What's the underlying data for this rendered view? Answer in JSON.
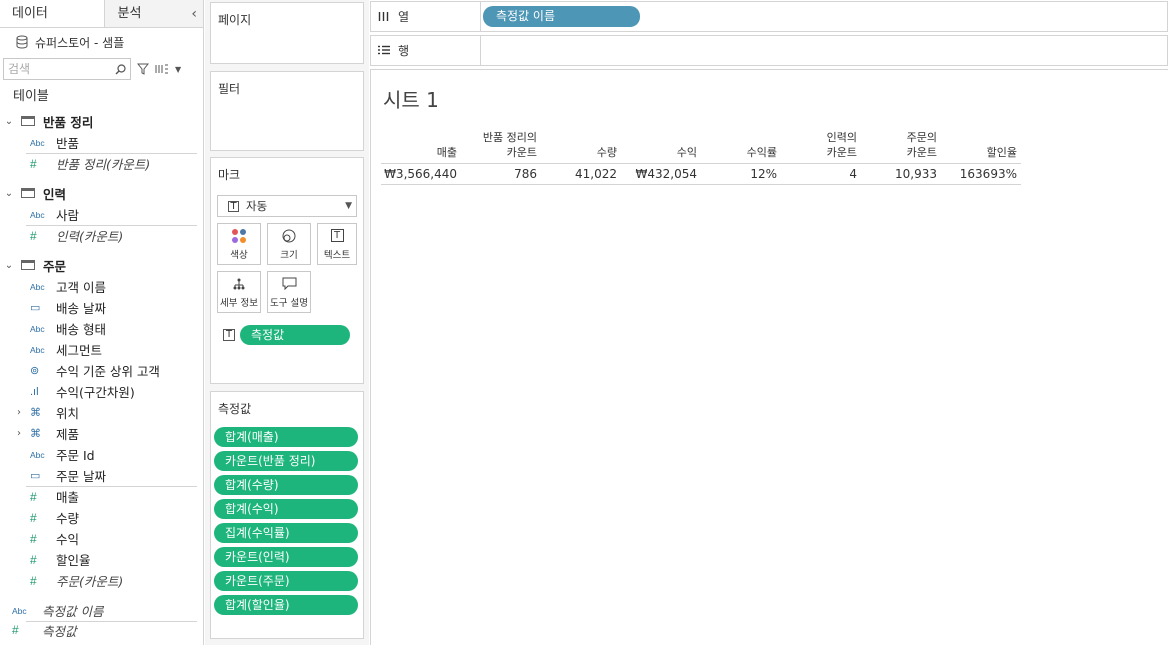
{
  "data_pane": {
    "tab_data": "데이터",
    "tab_analysis": "분석",
    "datasource": "슈퍼스토어 - 샘플",
    "search_placeholder": "검색",
    "tables_label": "테이블",
    "tables": [
      {
        "name": "반품 정리",
        "fields": [
          {
            "icon": "Abc",
            "label": "반품"
          },
          {
            "icon": "#",
            "label": "반품 정리(카운트)"
          }
        ]
      },
      {
        "name": "인력",
        "fields": [
          {
            "icon": "Abc",
            "label": "사람"
          },
          {
            "icon": "#",
            "label": "인력(카운트)"
          }
        ]
      },
      {
        "name": "주문",
        "fields": [
          {
            "icon": "Abc",
            "label": "고객 이름"
          },
          {
            "icon": "calendar",
            "label": "배송 날짜"
          },
          {
            "icon": "Abc",
            "label": "배송 형태"
          },
          {
            "icon": "Abc",
            "label": "세그먼트"
          },
          {
            "icon": "set",
            "label": "수익 기준 상위 고객"
          },
          {
            "icon": "bin",
            "label": "수익(구간차원)"
          },
          {
            "icon": "hierarchy",
            "label": "위치"
          },
          {
            "icon": "hierarchy",
            "label": "제품"
          },
          {
            "icon": "Abc",
            "label": "주문 Id"
          },
          {
            "icon": "calendar",
            "label": "주문 날짜"
          },
          {
            "icon": "#",
            "label": "매출"
          },
          {
            "icon": "#",
            "label": "수량"
          },
          {
            "icon": "#",
            "label": "수익"
          },
          {
            "icon": "#",
            "label": "할인율"
          },
          {
            "icon": "#",
            "label": "주문(카운트)"
          }
        ]
      }
    ],
    "measure_names": {
      "icon": "Abc",
      "label": "측정값 이름"
    },
    "measure_values_partial": "측정값"
  },
  "shelves": {
    "pages_label": "페이지",
    "filters_label": "필터",
    "marks_label": "마크",
    "mark_type": "자동",
    "mark_buttons": [
      "색상",
      "크기",
      "텍스트",
      "세부 정보",
      "도구 설명"
    ],
    "marks_pill": "측정값",
    "measures_label": "측정값",
    "measure_pills": [
      "합계(매출)",
      "카운트(반품 정리)",
      "합계(수량)",
      "합계(수익)",
      "집계(수익률)",
      "카운트(인력)",
      "카운트(주문)",
      "합계(할인율)"
    ]
  },
  "view": {
    "columns_label": "열",
    "rows_label": "행",
    "columns_pill": "측정값 이름",
    "sheet_title": "시트 1",
    "headers": [
      "매출",
      "반품 정리의\n카운트",
      "수량",
      "수익",
      "수익률",
      "인력의\n카운트",
      "주문의\n카운트",
      "할인율"
    ],
    "values": [
      "₩3,566,440",
      "786",
      "41,022",
      "₩432,054",
      "12%",
      "4",
      "10,933",
      "163693%"
    ]
  },
  "colors": {
    "measure_pill": "#1db57c",
    "dimension_pill": "#4e96b5"
  }
}
